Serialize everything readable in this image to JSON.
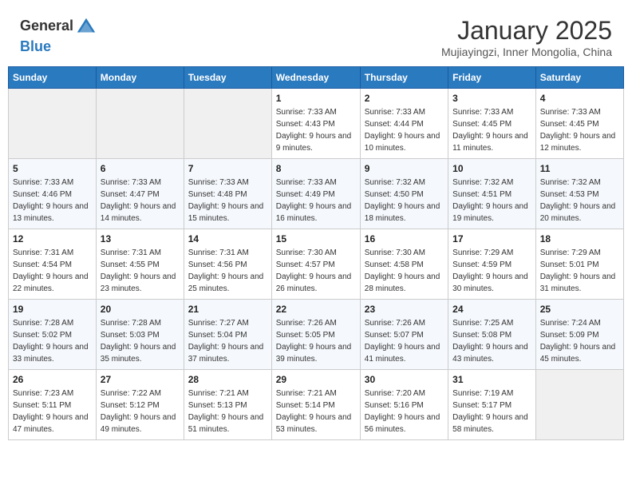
{
  "header": {
    "logo_general": "General",
    "logo_blue": "Blue",
    "month": "January 2025",
    "location": "Mujiayingzi, Inner Mongolia, China"
  },
  "days_of_week": [
    "Sunday",
    "Monday",
    "Tuesday",
    "Wednesday",
    "Thursday",
    "Friday",
    "Saturday"
  ],
  "weeks": [
    [
      {
        "day": "",
        "sunrise": "",
        "sunset": "",
        "daylight": ""
      },
      {
        "day": "",
        "sunrise": "",
        "sunset": "",
        "daylight": ""
      },
      {
        "day": "",
        "sunrise": "",
        "sunset": "",
        "daylight": ""
      },
      {
        "day": "1",
        "sunrise": "Sunrise: 7:33 AM",
        "sunset": "Sunset: 4:43 PM",
        "daylight": "Daylight: 9 hours and 9 minutes."
      },
      {
        "day": "2",
        "sunrise": "Sunrise: 7:33 AM",
        "sunset": "Sunset: 4:44 PM",
        "daylight": "Daylight: 9 hours and 10 minutes."
      },
      {
        "day": "3",
        "sunrise": "Sunrise: 7:33 AM",
        "sunset": "Sunset: 4:45 PM",
        "daylight": "Daylight: 9 hours and 11 minutes."
      },
      {
        "day": "4",
        "sunrise": "Sunrise: 7:33 AM",
        "sunset": "Sunset: 4:45 PM",
        "daylight": "Daylight: 9 hours and 12 minutes."
      }
    ],
    [
      {
        "day": "5",
        "sunrise": "Sunrise: 7:33 AM",
        "sunset": "Sunset: 4:46 PM",
        "daylight": "Daylight: 9 hours and 13 minutes."
      },
      {
        "day": "6",
        "sunrise": "Sunrise: 7:33 AM",
        "sunset": "Sunset: 4:47 PM",
        "daylight": "Daylight: 9 hours and 14 minutes."
      },
      {
        "day": "7",
        "sunrise": "Sunrise: 7:33 AM",
        "sunset": "Sunset: 4:48 PM",
        "daylight": "Daylight: 9 hours and 15 minutes."
      },
      {
        "day": "8",
        "sunrise": "Sunrise: 7:33 AM",
        "sunset": "Sunset: 4:49 PM",
        "daylight": "Daylight: 9 hours and 16 minutes."
      },
      {
        "day": "9",
        "sunrise": "Sunrise: 7:32 AM",
        "sunset": "Sunset: 4:50 PM",
        "daylight": "Daylight: 9 hours and 18 minutes."
      },
      {
        "day": "10",
        "sunrise": "Sunrise: 7:32 AM",
        "sunset": "Sunset: 4:51 PM",
        "daylight": "Daylight: 9 hours and 19 minutes."
      },
      {
        "day": "11",
        "sunrise": "Sunrise: 7:32 AM",
        "sunset": "Sunset: 4:53 PM",
        "daylight": "Daylight: 9 hours and 20 minutes."
      }
    ],
    [
      {
        "day": "12",
        "sunrise": "Sunrise: 7:31 AM",
        "sunset": "Sunset: 4:54 PM",
        "daylight": "Daylight: 9 hours and 22 minutes."
      },
      {
        "day": "13",
        "sunrise": "Sunrise: 7:31 AM",
        "sunset": "Sunset: 4:55 PM",
        "daylight": "Daylight: 9 hours and 23 minutes."
      },
      {
        "day": "14",
        "sunrise": "Sunrise: 7:31 AM",
        "sunset": "Sunset: 4:56 PM",
        "daylight": "Daylight: 9 hours and 25 minutes."
      },
      {
        "day": "15",
        "sunrise": "Sunrise: 7:30 AM",
        "sunset": "Sunset: 4:57 PM",
        "daylight": "Daylight: 9 hours and 26 minutes."
      },
      {
        "day": "16",
        "sunrise": "Sunrise: 7:30 AM",
        "sunset": "Sunset: 4:58 PM",
        "daylight": "Daylight: 9 hours and 28 minutes."
      },
      {
        "day": "17",
        "sunrise": "Sunrise: 7:29 AM",
        "sunset": "Sunset: 4:59 PM",
        "daylight": "Daylight: 9 hours and 30 minutes."
      },
      {
        "day": "18",
        "sunrise": "Sunrise: 7:29 AM",
        "sunset": "Sunset: 5:01 PM",
        "daylight": "Daylight: 9 hours and 31 minutes."
      }
    ],
    [
      {
        "day": "19",
        "sunrise": "Sunrise: 7:28 AM",
        "sunset": "Sunset: 5:02 PM",
        "daylight": "Daylight: 9 hours and 33 minutes."
      },
      {
        "day": "20",
        "sunrise": "Sunrise: 7:28 AM",
        "sunset": "Sunset: 5:03 PM",
        "daylight": "Daylight: 9 hours and 35 minutes."
      },
      {
        "day": "21",
        "sunrise": "Sunrise: 7:27 AM",
        "sunset": "Sunset: 5:04 PM",
        "daylight": "Daylight: 9 hours and 37 minutes."
      },
      {
        "day": "22",
        "sunrise": "Sunrise: 7:26 AM",
        "sunset": "Sunset: 5:05 PM",
        "daylight": "Daylight: 9 hours and 39 minutes."
      },
      {
        "day": "23",
        "sunrise": "Sunrise: 7:26 AM",
        "sunset": "Sunset: 5:07 PM",
        "daylight": "Daylight: 9 hours and 41 minutes."
      },
      {
        "day": "24",
        "sunrise": "Sunrise: 7:25 AM",
        "sunset": "Sunset: 5:08 PM",
        "daylight": "Daylight: 9 hours and 43 minutes."
      },
      {
        "day": "25",
        "sunrise": "Sunrise: 7:24 AM",
        "sunset": "Sunset: 5:09 PM",
        "daylight": "Daylight: 9 hours and 45 minutes."
      }
    ],
    [
      {
        "day": "26",
        "sunrise": "Sunrise: 7:23 AM",
        "sunset": "Sunset: 5:11 PM",
        "daylight": "Daylight: 9 hours and 47 minutes."
      },
      {
        "day": "27",
        "sunrise": "Sunrise: 7:22 AM",
        "sunset": "Sunset: 5:12 PM",
        "daylight": "Daylight: 9 hours and 49 minutes."
      },
      {
        "day": "28",
        "sunrise": "Sunrise: 7:21 AM",
        "sunset": "Sunset: 5:13 PM",
        "daylight": "Daylight: 9 hours and 51 minutes."
      },
      {
        "day": "29",
        "sunrise": "Sunrise: 7:21 AM",
        "sunset": "Sunset: 5:14 PM",
        "daylight": "Daylight: 9 hours and 53 minutes."
      },
      {
        "day": "30",
        "sunrise": "Sunrise: 7:20 AM",
        "sunset": "Sunset: 5:16 PM",
        "daylight": "Daylight: 9 hours and 56 minutes."
      },
      {
        "day": "31",
        "sunrise": "Sunrise: 7:19 AM",
        "sunset": "Sunset: 5:17 PM",
        "daylight": "Daylight: 9 hours and 58 minutes."
      },
      {
        "day": "",
        "sunrise": "",
        "sunset": "",
        "daylight": ""
      }
    ]
  ]
}
